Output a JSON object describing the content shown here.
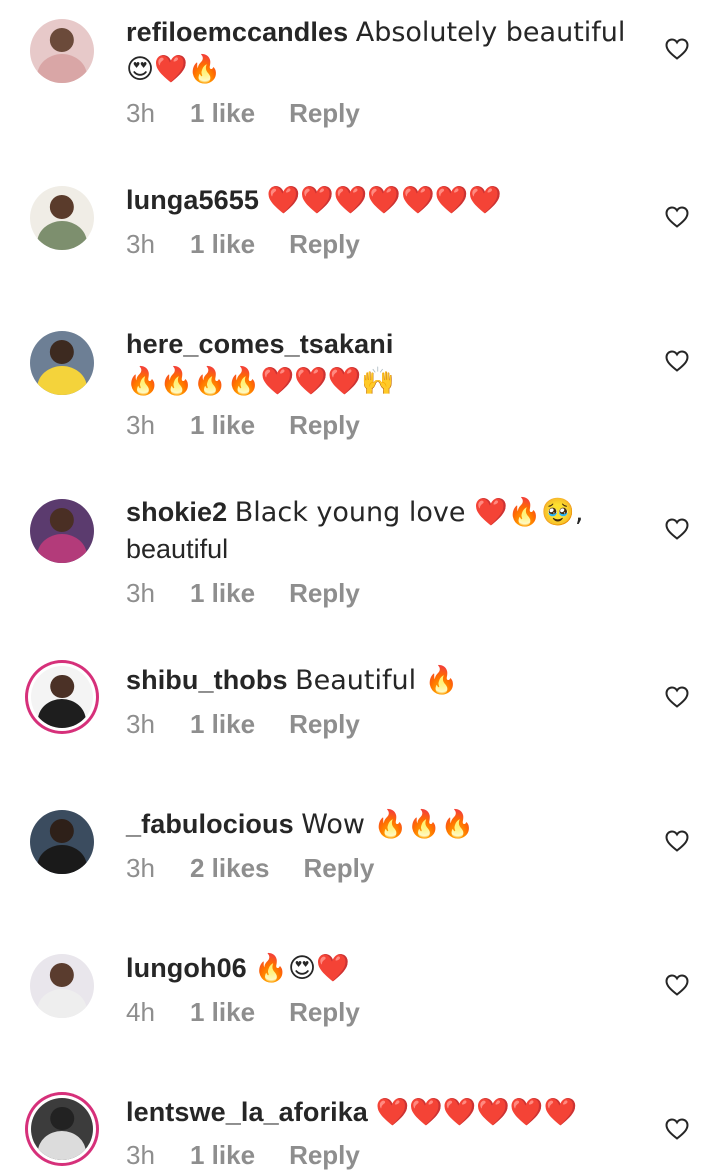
{
  "comments": [
    {
      "username": "refiloemccandles",
      "text": "Absolutely beautiful",
      "line2": "😍❤️🔥",
      "time": "3h",
      "likes": "1 like",
      "reply": "Reply",
      "avatar": {
        "bg": "#e7c9c9",
        "skin": "#6b4a3a",
        "shirt": "#d9a6a6"
      }
    },
    {
      "username": "lunga5655",
      "text": "❤️❤️❤️❤️❤️❤️❤️",
      "line2": "",
      "time": "3h",
      "likes": "1 like",
      "reply": "Reply",
      "avatar": {
        "bg": "#f0ede6",
        "skin": "#5a3b2b",
        "shirt": "#7d8f6e"
      }
    },
    {
      "username": "here_comes_tsakani",
      "text": "",
      "line2": "🔥🔥🔥🔥❤️❤️❤️🙌",
      "time": "3h",
      "likes": "1 like",
      "reply": "Reply",
      "avatar": {
        "bg": "#6d7f95",
        "skin": "#3d2a20",
        "shirt": "#f4d33b"
      }
    },
    {
      "username": "shokie2",
      "text": "Black young love ❤️🔥🥹,",
      "line2": "beautiful",
      "time": "3h",
      "likes": "1 like",
      "reply": "Reply",
      "avatar": {
        "bg": "#5b3b6e",
        "skin": "#4a2f24",
        "shirt": "#b33b7a"
      }
    },
    {
      "username": "shibu_thobs",
      "text": "Beautiful 🔥",
      "line2": "",
      "time": "3h",
      "likes": "1 like",
      "reply": "Reply",
      "avatar": {
        "bg": "#f4f4f4",
        "skin": "#4b3126",
        "shirt": "#1e1e1e"
      }
    },
    {
      "username": "_fabulocious",
      "text": "Wow 🔥🔥🔥",
      "line2": "",
      "time": "3h",
      "likes": "2 likes",
      "reply": "Reply",
      "avatar": {
        "bg": "#3b4c5f",
        "skin": "#2e2019",
        "shirt": "#1a1a1a"
      }
    },
    {
      "username": "lungoh06",
      "text": "🔥😍❤️",
      "line2": "",
      "time": "4h",
      "likes": "1 like",
      "reply": "Reply",
      "avatar": {
        "bg": "#e9e6ec",
        "skin": "#5a3c2e",
        "shirt": "#eeeeee"
      }
    },
    {
      "username": "lentswe_la_aforika",
      "text": "❤️❤️❤️❤️❤️❤️",
      "line2": "",
      "time": "3h",
      "likes": "1 like",
      "reply": "Reply",
      "avatar": {
        "bg": "#3c3c3c",
        "skin": "#222222",
        "shirt": "#dcdcdc"
      }
    }
  ]
}
